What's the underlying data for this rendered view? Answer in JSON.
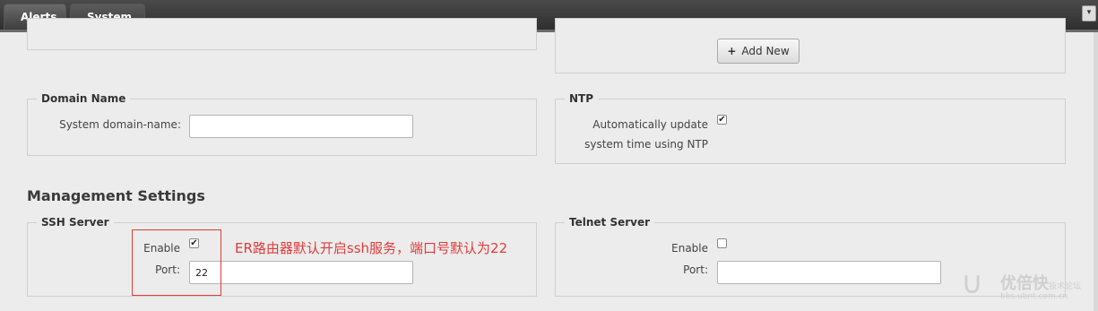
{
  "tabs": [
    {
      "label": "Alerts"
    },
    {
      "label": "System"
    }
  ],
  "top_right": {
    "icon": "chevron-down-icon"
  },
  "add_new_button": {
    "label": "Add New",
    "icon": "plus-icon"
  },
  "domain": {
    "legend": "Domain Name",
    "field_label": "System domain-name:",
    "value": ""
  },
  "ntp": {
    "legend": "NTP",
    "label_line1": "Automatically update",
    "label_line2": "system time using NTP",
    "checked": true
  },
  "management": {
    "title": "Management Settings"
  },
  "ssh": {
    "legend": "SSH Server",
    "enable_label": "Enable",
    "enable_checked": true,
    "port_label": "Port:",
    "port_value": "22"
  },
  "telnet": {
    "legend": "Telnet Server",
    "enable_label": "Enable",
    "enable_checked": false,
    "port_label": "Port:",
    "port_value": ""
  },
  "annotation": {
    "text": "ER路由器默认开启ssh服务，端口号默认为22",
    "color": "#e23b3b"
  },
  "watermark": {
    "brand": "优倍快",
    "sub": "技术论坛",
    "url": "bbs.ubnt.com.cn"
  }
}
